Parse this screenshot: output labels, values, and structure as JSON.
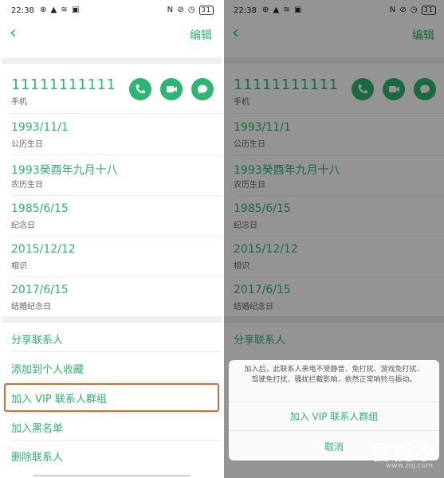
{
  "status_bar": {
    "time": "22:38",
    "left_icons": "⊕ ▲ ≋ ▣",
    "right_icons": "N ⊘ ◷",
    "battery": "31"
  },
  "header": {
    "back_icon": "‹",
    "edit_label": "编辑"
  },
  "contact": {
    "phone_number": "11111111111",
    "phone_type": "手机"
  },
  "actions": {
    "call": "phone-icon",
    "video": "video-icon",
    "message": "message-icon"
  },
  "dates": [
    {
      "value": "1993/11/1",
      "label": "公历生日"
    },
    {
      "value": "1993癸酉年九月十八",
      "label": "农历生日"
    },
    {
      "value": "1985/6/15",
      "label": "纪念日"
    },
    {
      "value": "2015/12/12",
      "label": "相识"
    },
    {
      "value": "2017/6/15",
      "label": "结婚纪念日"
    }
  ],
  "menu": {
    "share": "分享联系人",
    "favorite": "添加到个人收藏",
    "vip": "加入 VIP 联系人群组",
    "blacklist": "加入黑名单",
    "delete": "删除联系人"
  },
  "dialog": {
    "message": "加入后，此联系人来电不受静音、免打扰、游戏免打扰、驾驶免打扰、骚扰拦截影响，依然正常响铃与振动。",
    "confirm": "加入 VIP 联系人群组",
    "cancel": "取消"
  },
  "watermark": {
    "logo": "智能家",
    "url": "www.znj.com"
  },
  "colors": {
    "accent": "#2db671",
    "highlight": "#e0692a"
  }
}
